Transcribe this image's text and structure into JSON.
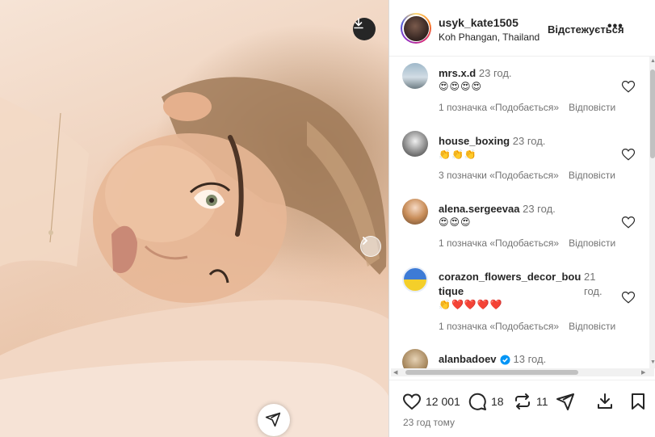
{
  "post": {
    "username": "usyk_kate1505",
    "location": "Koh Phangan, Thailand",
    "follow_label": "Відстежується",
    "more_label": "•••"
  },
  "comments": [
    {
      "user": "mrs.x.d",
      "time": "23 год.",
      "text": "😍😍😍😍",
      "likes": "1 позначка «Подобається»",
      "reply": "Відповісти"
    },
    {
      "user": "house_boxing",
      "time": "23 год.",
      "text": "👏👏👏",
      "likes": "3 позначки «Подобається»",
      "reply": "Відповісти"
    },
    {
      "user": "alena.sergeevaa",
      "time": "23 год.",
      "text": "😍😍😍",
      "likes": "1 позначка «Подобається»",
      "reply": "Відповісти"
    },
    {
      "user": "corazon_flowers_decor_bou tique",
      "time": "21 год.",
      "text": "👏❤️❤️❤️❤️",
      "likes": "1 позначка «Подобається»",
      "reply": "Відповісти"
    },
    {
      "user": "alanbadoev",
      "time": "13 год.",
      "verified": true
    }
  ],
  "actions": {
    "likes": "12 001",
    "comments": "18",
    "reposts": "11",
    "posted": "23 год тому"
  },
  "colors": {
    "accent": "#0095f6",
    "text": "#262626",
    "secondary": "#737373"
  },
  "icons": [
    "download-icon",
    "chevron-right-icon",
    "heart-icon",
    "comment-icon",
    "repost-icon",
    "share-icon",
    "save-icon",
    "verified-icon"
  ]
}
